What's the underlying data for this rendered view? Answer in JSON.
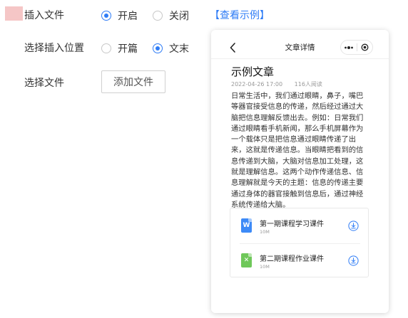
{
  "colors": {
    "accent": "#2e7cf6",
    "word_icon": "#3d8af7",
    "excel_icon": "#6fc85a",
    "redacted_block": "#f5c6c6"
  },
  "form": {
    "insert_file": {
      "label": "插入文件",
      "options": [
        {
          "label": "开启",
          "checked": true
        },
        {
          "label": "关闭",
          "checked": false
        }
      ],
      "example_link": "【查看示例】"
    },
    "position": {
      "label": "选择插入位置",
      "options": [
        {
          "label": "开篇",
          "checked": false
        },
        {
          "label": "文末",
          "checked": true
        }
      ]
    },
    "select_file": {
      "label": "选择文件",
      "button": "添加文件"
    }
  },
  "preview": {
    "nav": {
      "back_icon": "chevron-left-icon",
      "title": "文章详情",
      "more_icon": "more-dots-icon",
      "close_icon": "record-circle-icon"
    },
    "article": {
      "title": "示例文章",
      "date": "2022-04-26 17:00",
      "reads": "116人阅读",
      "body": "日常生活中，我们通过眼睛，鼻子，嘴巴等器官接受信息的传递，然后经过通过大脑把信息理解反馈出去。例如：日常我们通过眼睛看手机新闻，那么手机屏幕作为一个载体只是把信息通过眼睛传递了出来，这就是传递信息。当眼睛把看到的信息传递到大脑，大脑对信息加工处理，这就是理解信息。这两个动作传递信息、信息理解就是今天的主题：信息的传递主要通过身体的器官接触到信息后，通过神经系统传递给大脑。"
    },
    "files": [
      {
        "name": "第一期课程学习课件",
        "size": "10M",
        "icon": "word-file-icon",
        "glyph": "W"
      },
      {
        "name": "第二期课程作业课件",
        "size": "10M",
        "icon": "excel-file-icon",
        "glyph": "✕"
      }
    ],
    "download_icon": "download-icon"
  }
}
